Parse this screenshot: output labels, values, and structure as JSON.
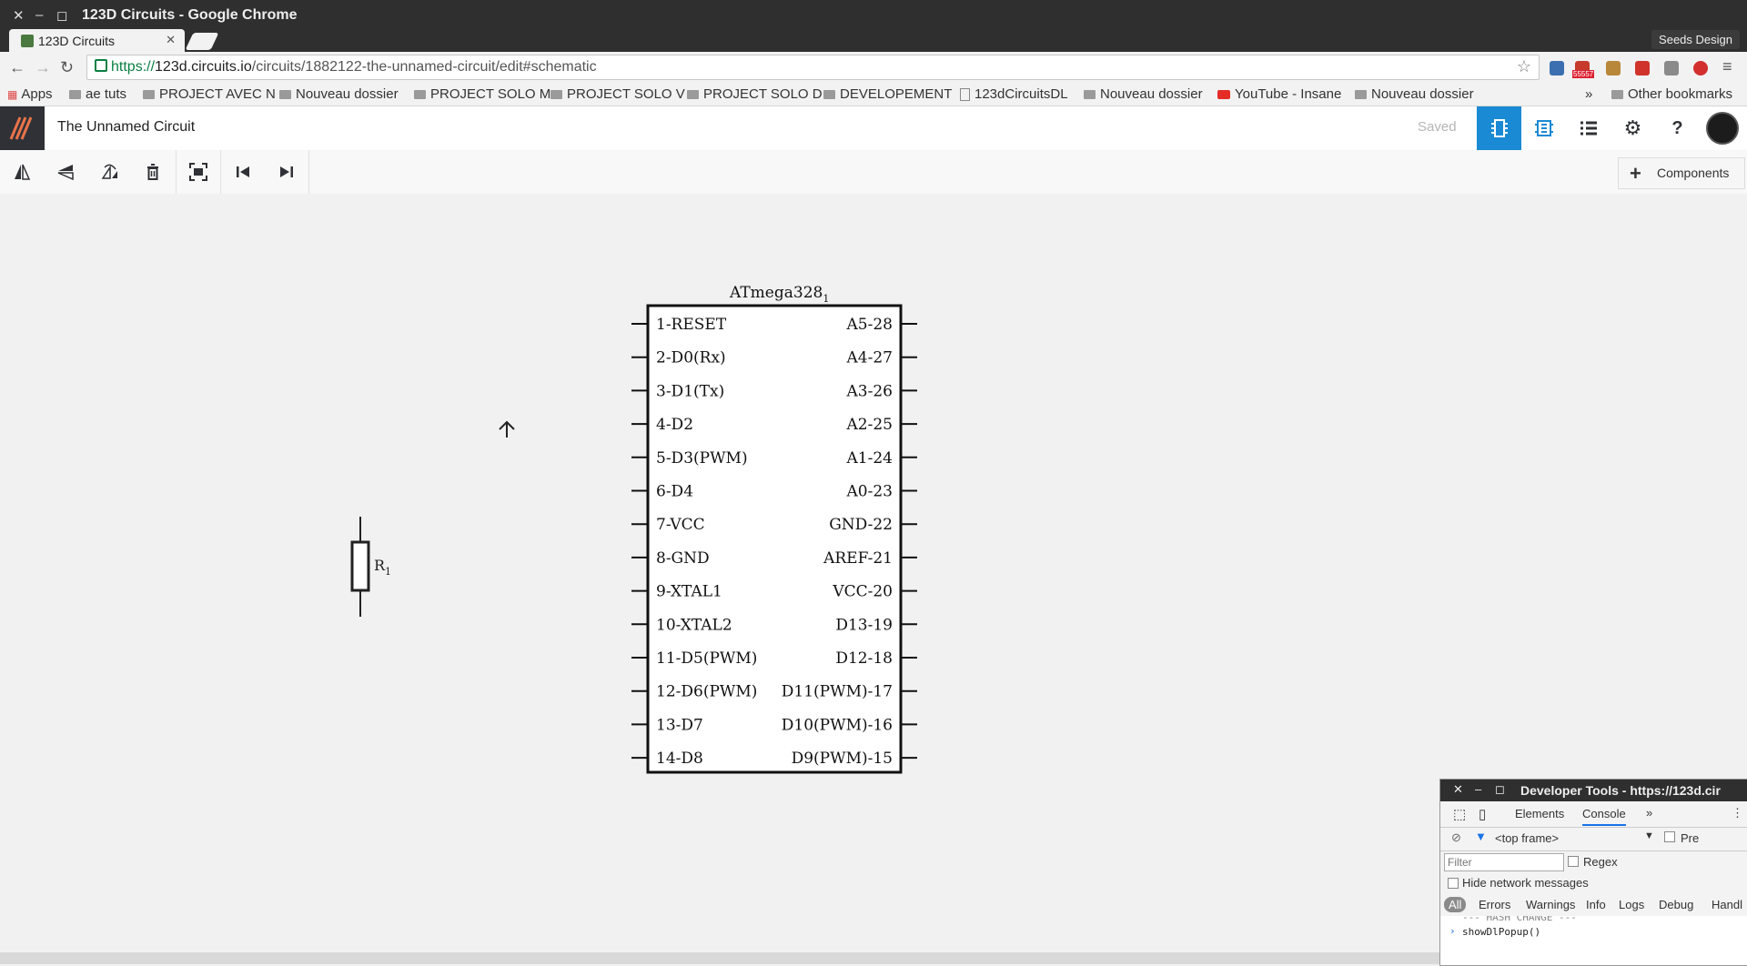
{
  "window": {
    "title": "123D Circuits - Google Chrome",
    "profile": "Seeds Design"
  },
  "tab": {
    "title": "123D Circuits"
  },
  "address": {
    "scheme": "https://",
    "host": "123d.circuits.io",
    "path": "/circuits/1882122-the-unnamed-circuit/edit#schematic"
  },
  "extension_badge": "55557",
  "bookmarks": [
    "Apps",
    "ae tuts",
    "PROJECT AVEC N",
    "Nouveau dossier",
    "PROJECT SOLO M",
    "PROJECT SOLO V",
    "PROJECT SOLO D",
    "DEVELOPEMENT",
    "123dCircuitsDL",
    "Nouveau dossier",
    "YouTube - Insane",
    "Nouveau dossier"
  ],
  "bookmarks_overflow": "»",
  "other_bookmarks": "Other bookmarks",
  "app": {
    "circuit_name": "The Unnamed Circuit",
    "status": "Saved",
    "components_label": "Components"
  },
  "schematic": {
    "chip_name": "ATmega328",
    "chip_subscript": "1",
    "left_pins": [
      "1-RESET",
      "2-D0(Rx)",
      "3-D1(Tx)",
      "4-D2",
      "5-D3(PWM)",
      "6-D4",
      "7-VCC",
      "8-GND",
      "9-XTAL1",
      "10-XTAL2",
      "11-D5(PWM)",
      "12-D6(PWM)",
      "13-D7",
      "14-D8"
    ],
    "right_pins": [
      "A5-28",
      "A4-27",
      "A3-26",
      "A2-25",
      "A1-24",
      "A0-23",
      "GND-22",
      "AREF-21",
      "VCC-20",
      "D13-19",
      "D12-18",
      "D11(PWM)-17",
      "D10(PWM)-16",
      "D9(PWM)-15"
    ],
    "resistor_label": "R",
    "resistor_subscript": "1"
  },
  "devtools": {
    "title": "Developer Tools - https://123d.cir",
    "tabs": [
      "Elements",
      "Console"
    ],
    "active_tab": "Console",
    "frame": "<top frame>",
    "preserve_label": "Pre",
    "filter_placeholder": "Filter",
    "regex_label": "Regex",
    "hide_network_label": "Hide network messages",
    "levels": [
      "All",
      "Errors",
      "Warnings",
      "Info",
      "Logs",
      "Debug",
      "Handl"
    ],
    "log_line": "--- HASH CHANGE ---",
    "prompt_line": "showDlPopup()"
  },
  "colors": {
    "accent": "#1a8ad4",
    "dark": "#2f2f2f",
    "logo_bg": "#2f3136",
    "logo_fg": "#e8734a"
  }
}
